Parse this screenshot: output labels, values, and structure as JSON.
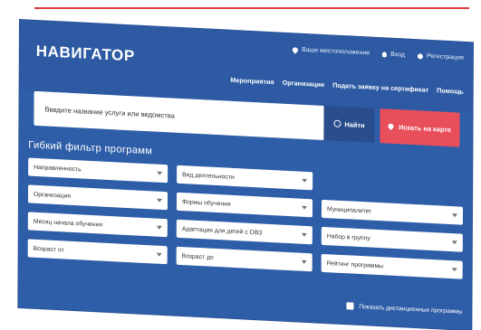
{
  "header": {
    "logo": "НАВИГАТОР",
    "topbar": [
      {
        "label": "Ваше местоположение",
        "icon": "location-pin-icon"
      },
      {
        "label": "Вход",
        "icon": "user-icon"
      },
      {
        "label": "Регистрация",
        "icon": "account-circle-icon"
      }
    ],
    "nav": [
      "Мероприятия",
      "Организации",
      "Подать заявку на сертификат",
      "Помощь"
    ]
  },
  "search": {
    "placeholder": "Введите название услуги или ведомства",
    "find_label": "Найти",
    "map_label": "Искать на карте"
  },
  "filter": {
    "title": "Гибкий фильтр программ",
    "fields": [
      {
        "label": "Направленность"
      },
      {
        "label": "Вид деятельности"
      },
      {
        "label": ""
      },
      {
        "label": "Организация"
      },
      {
        "label": "Формы обучения"
      },
      {
        "label": "Муниципалитет"
      },
      {
        "label": "Месяц начала обучения"
      },
      {
        "label": "Адаптация для детей с ОВЗ"
      },
      {
        "label": "Набор в группу"
      },
      {
        "label": "Возраст от"
      },
      {
        "label": "Возраст до"
      },
      {
        "label": "Рейтинг программы"
      }
    ],
    "remote_label": "Показать дистанционные программы"
  },
  "colors": {
    "primary": "#2d5aa3",
    "accent": "#e94e5b",
    "button_dark": "#2a4d8d"
  }
}
